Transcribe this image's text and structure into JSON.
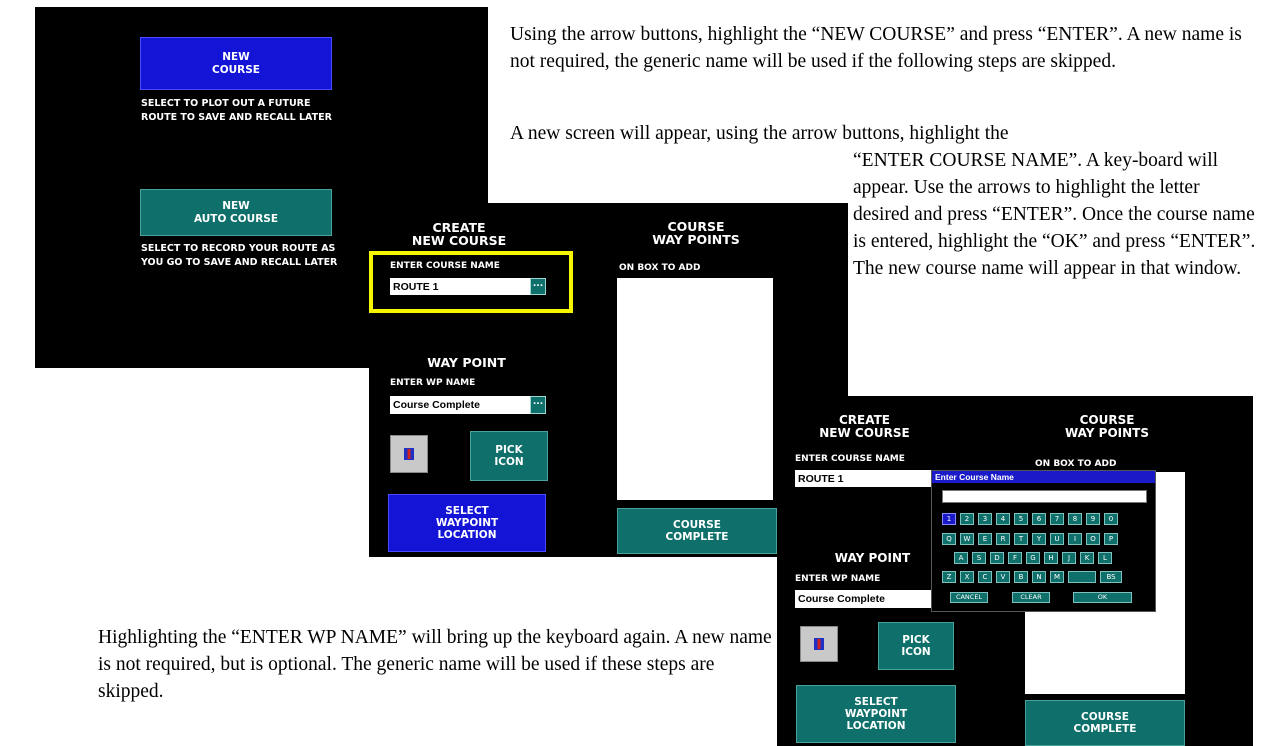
{
  "instructions": {
    "para1": "Using the arrow buttons, highlight the “NEW COURSE” and press “ENTER”. A new name is not required, the generic name will be used if the following steps are skipped.",
    "para2_line1": "A new screen will appear, using the arrow buttons, highlight the",
    "para2_rest": "“ENTER COURSE NAME”. A key-board will appear. Use the arrows to highlight the letter desired and press “ENTER”. Once the course name is entered, highlight the “OK” and press “ENTER”. The new course name will appear in that window.",
    "para3": "Highlighting the “ENTER WP NAME” will bring up the keyboard again. A new name is not required, but is optional. The generic name will be used if these steps are skipped."
  },
  "screen1": {
    "new_course_button": "NEW\nCOURSE",
    "new_course_desc": "SELECT TO PLOT OUT A FUTURE\nROUTE TO SAVE AND RECALL LATER",
    "new_auto_course_button": "NEW\nAUTO COURSE",
    "new_auto_course_desc": "SELECT TO RECORD YOUR ROUTE AS\nYOU GO TO SAVE AND RECALL LATER"
  },
  "screen2": {
    "create_heading": "CREATE\nNEW COURSE",
    "waypoints_heading": "COURSE\nWAY POINTS",
    "enter_course_name_label": "ENTER COURSE NAME",
    "course_name_value": "ROUTE 1",
    "browse_label": "...",
    "on_box_to_add": "ON BOX TO ADD",
    "way_point_heading": "WAY POINT",
    "enter_wp_name_label": "ENTER WP NAME",
    "wp_name_value": "Course Complete",
    "pick_icon_button": "PICK\nICON",
    "select_waypoint_button": "SELECT\nWAYPOINT\nLOCATION",
    "course_complete_button": "COURSE\nCOMPLETE",
    "highlight_color": "#f5f500"
  },
  "screen3": {
    "create_heading": "CREATE\nNEW COURSE",
    "waypoints_heading": "COURSE\nWAY POINTS",
    "enter_course_name_label": "ENTER COURSE NAME",
    "course_name_value": "ROUTE 1",
    "on_box_to_add": "ON BOX TO ADD",
    "way_point_heading": "WAY POINT",
    "enter_wp_name_label": "ENTER WP NAME",
    "wp_name_value": "Course Complete",
    "pick_icon_button": "PICK\nICON",
    "select_waypoint_button": "SELECT\nWAYPOINT\nLOCATION",
    "course_complete_button": "COURSE\nCOMPLETE",
    "keyboard": {
      "title": "Enter Course Name",
      "input_value": "",
      "row1": [
        "1",
        "2",
        "3",
        "4",
        "5",
        "6",
        "7",
        "8",
        "9",
        "0"
      ],
      "row2": [
        "Q",
        "W",
        "E",
        "R",
        "T",
        "Y",
        "U",
        "I",
        "O",
        "P"
      ],
      "row3": [
        "A",
        "S",
        "D",
        "F",
        "G",
        "H",
        "J",
        "K",
        "L"
      ],
      "row4": [
        "Z",
        "X",
        "C",
        "V",
        "B",
        "N",
        "M",
        "",
        "BS"
      ],
      "cancel": "CANCEL",
      "clear": "CLEAR",
      "ok": "OK"
    }
  }
}
